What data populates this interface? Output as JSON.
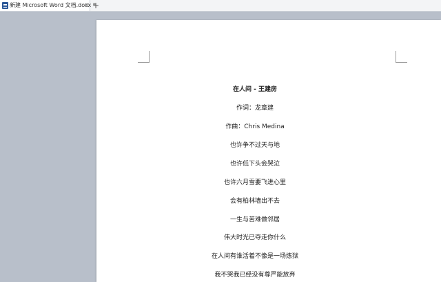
{
  "tab": {
    "title": "新建 Microsoft Word 文档.docx *",
    "close": "×",
    "new_tab": "+"
  },
  "document": {
    "lines": [
      "在人间 - 王建房",
      "作词：龙章建",
      "作曲：Chris Medina",
      "也许争不过天与地",
      "也许低下头会哭泣",
      "也许六月雪要飞进心里",
      "会有柏林墙出不去",
      "一生与苦难做邻居",
      "伟大时光已夺走你什么",
      "在人间有谁活着不像是一场炼狱",
      "我不哭我已经没有尊严能放弃"
    ]
  },
  "colors": {
    "workspace": "#b8bfca",
    "page": "#ffffff",
    "tab_active": "#ffffff",
    "word_icon": "#2b5797"
  },
  "icons": {
    "tab_icon": "word-document-icon"
  }
}
